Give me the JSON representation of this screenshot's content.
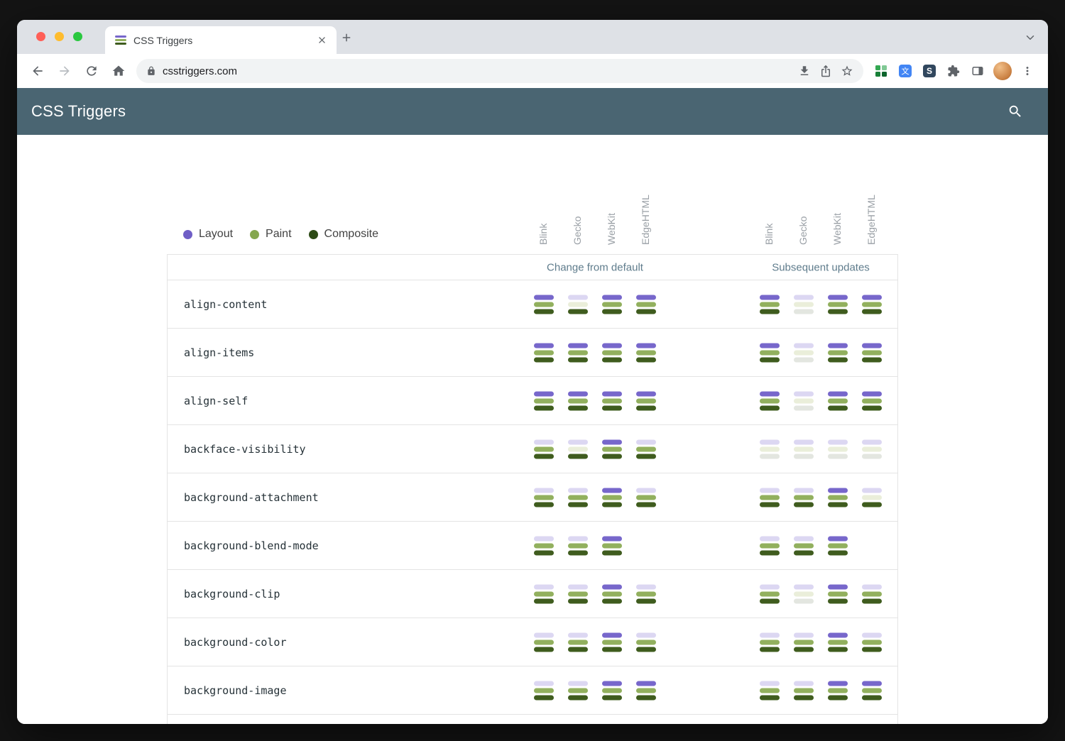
{
  "browser_chrome": {
    "tab": {
      "title": "CSS Triggers"
    },
    "address": {
      "url": "csstriggers.com"
    },
    "extensions": {
      "s_label": "S",
      "translate_glyph": "文"
    }
  },
  "site": {
    "header_title": "CSS Triggers",
    "header_bg": "#4a6572"
  },
  "legend": {
    "items": [
      {
        "label": "Layout",
        "color": "#6f5ec6"
      },
      {
        "label": "Paint",
        "color": "#85a74e"
      },
      {
        "label": "Composite",
        "color": "#2c4a15"
      }
    ]
  },
  "matrix": {
    "browsers": [
      "Blink",
      "Gecko",
      "WebKit",
      "EdgeHTML"
    ],
    "group_headers": [
      "Change from default",
      "Subsequent updates"
    ],
    "bar_kinds": [
      "layout",
      "paint",
      "composite"
    ],
    "bar_colors": {
      "layout_on": "#7767cb",
      "layout_off": "#dcd7f2",
      "paint_on": "#92b05e",
      "paint_off": "#eaeeda",
      "composite_on": "#3f5c1e",
      "composite_off": "#e3e6e0"
    },
    "rows": [
      {
        "property": "align-content",
        "change": [
          [
            1,
            1,
            1
          ],
          [
            0,
            0,
            1
          ],
          [
            1,
            1,
            1
          ],
          [
            1,
            1,
            1
          ]
        ],
        "subsequent": [
          [
            1,
            1,
            1
          ],
          [
            0,
            0,
            0
          ],
          [
            1,
            1,
            1
          ],
          [
            1,
            1,
            1
          ]
        ]
      },
      {
        "property": "align-items",
        "change": [
          [
            1,
            1,
            1
          ],
          [
            1,
            1,
            1
          ],
          [
            1,
            1,
            1
          ],
          [
            1,
            1,
            1
          ]
        ],
        "subsequent": [
          [
            1,
            1,
            1
          ],
          [
            0,
            0,
            0
          ],
          [
            1,
            1,
            1
          ],
          [
            1,
            1,
            1
          ]
        ]
      },
      {
        "property": "align-self",
        "change": [
          [
            1,
            1,
            1
          ],
          [
            1,
            1,
            1
          ],
          [
            1,
            1,
            1
          ],
          [
            1,
            1,
            1
          ]
        ],
        "subsequent": [
          [
            1,
            1,
            1
          ],
          [
            0,
            0,
            0
          ],
          [
            1,
            1,
            1
          ],
          [
            1,
            1,
            1
          ]
        ]
      },
      {
        "property": "backface-visibility",
        "change": [
          [
            0,
            1,
            1
          ],
          [
            0,
            0,
            1
          ],
          [
            1,
            1,
            1
          ],
          [
            0,
            1,
            1
          ]
        ],
        "subsequent": [
          [
            0,
            0,
            0
          ],
          [
            0,
            0,
            0
          ],
          [
            0,
            0,
            0
          ],
          [
            0,
            0,
            0
          ]
        ]
      },
      {
        "property": "background-attachment",
        "change": [
          [
            0,
            1,
            1
          ],
          [
            0,
            1,
            1
          ],
          [
            1,
            1,
            1
          ],
          [
            0,
            1,
            1
          ]
        ],
        "subsequent": [
          [
            0,
            1,
            1
          ],
          [
            0,
            1,
            1
          ],
          [
            1,
            1,
            1
          ],
          [
            0,
            0,
            1
          ]
        ]
      },
      {
        "property": "background-blend-mode",
        "change": [
          [
            0,
            1,
            1
          ],
          [
            0,
            1,
            1
          ],
          [
            1,
            1,
            1
          ],
          null
        ],
        "subsequent": [
          [
            0,
            1,
            1
          ],
          [
            0,
            1,
            1
          ],
          [
            1,
            1,
            1
          ],
          null
        ]
      },
      {
        "property": "background-clip",
        "change": [
          [
            0,
            1,
            1
          ],
          [
            0,
            1,
            1
          ],
          [
            1,
            1,
            1
          ],
          [
            0,
            1,
            1
          ]
        ],
        "subsequent": [
          [
            0,
            1,
            1
          ],
          [
            0,
            0,
            0
          ],
          [
            1,
            1,
            1
          ],
          [
            0,
            1,
            1
          ]
        ]
      },
      {
        "property": "background-color",
        "change": [
          [
            0,
            1,
            1
          ],
          [
            0,
            1,
            1
          ],
          [
            1,
            1,
            1
          ],
          [
            0,
            1,
            1
          ]
        ],
        "subsequent": [
          [
            0,
            1,
            1
          ],
          [
            0,
            1,
            1
          ],
          [
            1,
            1,
            1
          ],
          [
            0,
            1,
            1
          ]
        ]
      },
      {
        "property": "background-image",
        "change": [
          [
            0,
            1,
            1
          ],
          [
            0,
            1,
            1
          ],
          [
            1,
            1,
            1
          ],
          [
            1,
            1,
            1
          ]
        ],
        "subsequent": [
          [
            0,
            1,
            1
          ],
          [
            0,
            1,
            1
          ],
          [
            1,
            1,
            1
          ],
          [
            1,
            1,
            1
          ]
        ]
      }
    ]
  }
}
